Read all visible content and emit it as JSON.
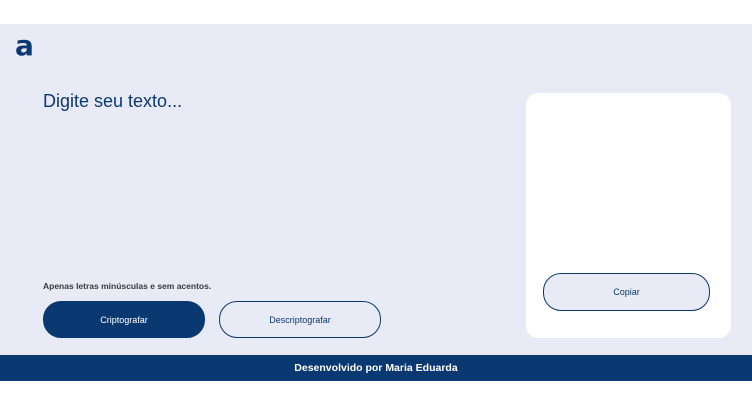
{
  "header": {
    "logo_text": "a"
  },
  "input": {
    "placeholder": "Digite seu texto...",
    "value": ""
  },
  "hint": {
    "text": "Apenas letras minúsculas e sem acentos."
  },
  "buttons": {
    "encrypt_label": "Criptografar",
    "decrypt_label": "Descriptografar"
  },
  "output": {
    "copy_label": "Copiar"
  },
  "footer": {
    "text": "Desenvolvido por Maria Eduarda"
  },
  "colors": {
    "primary": "#0a3871",
    "background": "#e8eaf6",
    "card": "#ffffff",
    "hint_text": "#343a40"
  }
}
